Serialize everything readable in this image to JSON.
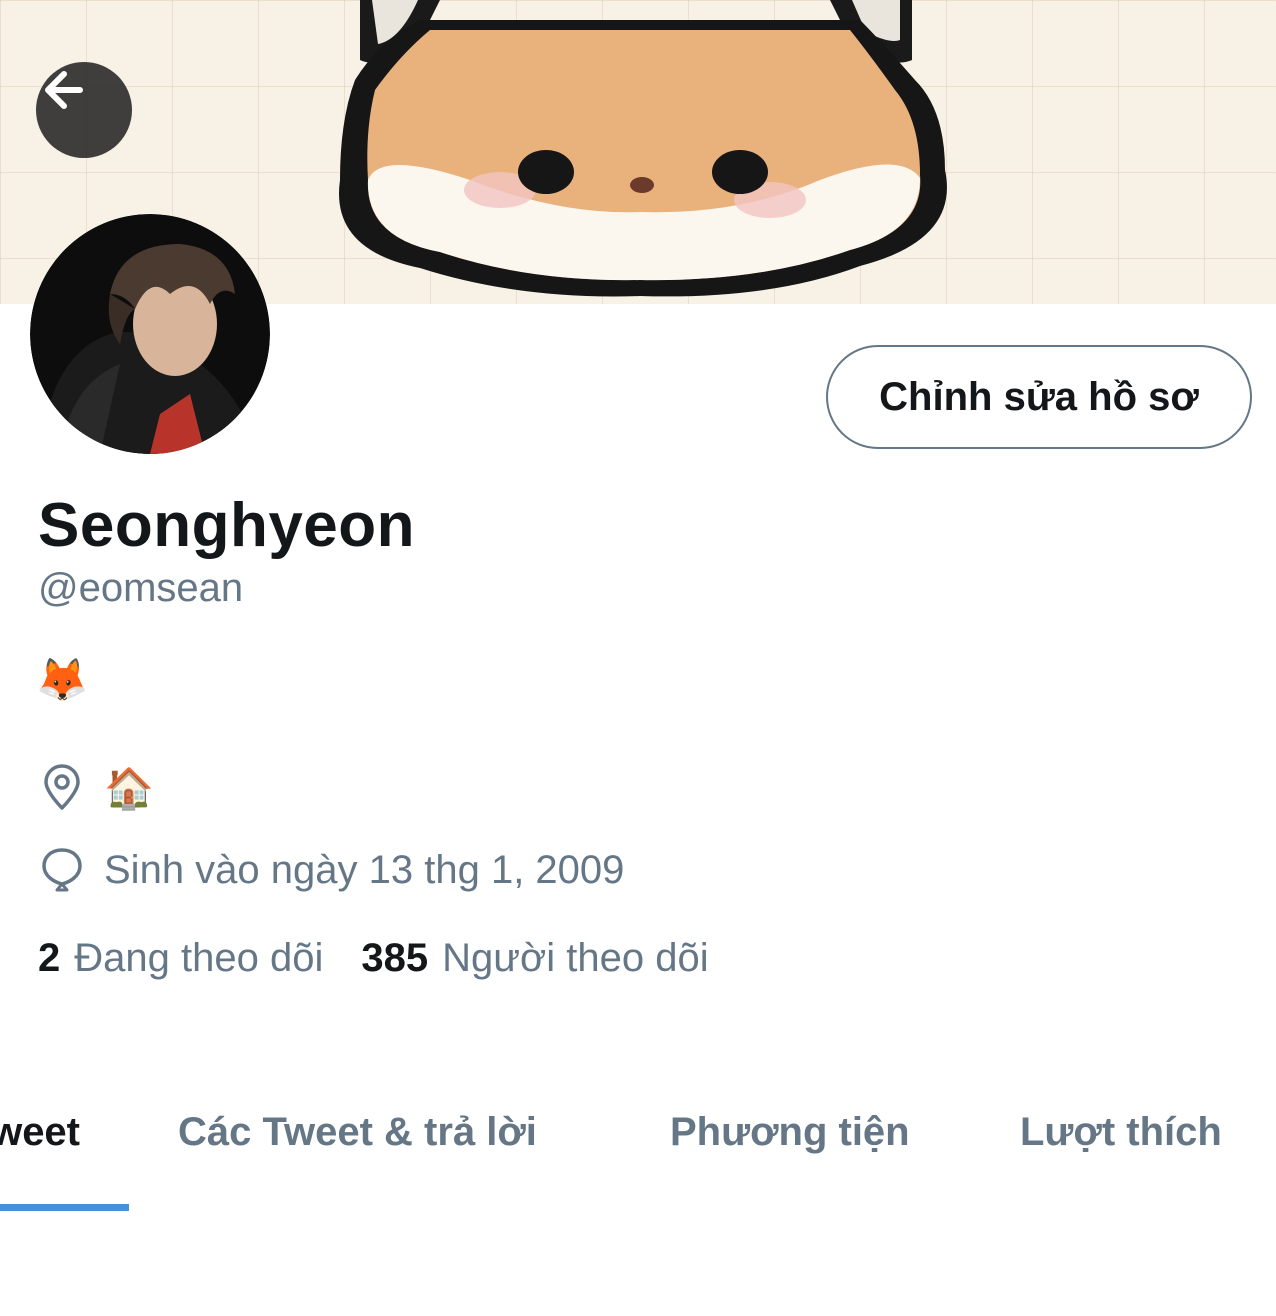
{
  "profile": {
    "edit_button_label": "Chỉnh sửa hồ sơ",
    "display_name": "Seonghyeon",
    "handle": "@eomsean",
    "bio": "🦊",
    "location": "🏠",
    "birthday": "Sinh vào ngày 13 thg 1, 2009",
    "following_count": "2",
    "following_label": "Đang theo dõi",
    "followers_count": "385",
    "followers_label": "Người theo dõi"
  },
  "tabs": [
    {
      "label": "Tweet",
      "active": true
    },
    {
      "label": "Các Tweet & trả lời",
      "active": false
    },
    {
      "label": "Phương tiện",
      "active": false
    },
    {
      "label": "Lượt thích",
      "active": false
    }
  ],
  "colors": {
    "text_primary": "#14171a",
    "text_secondary": "#657786",
    "accent": "#4a90d9",
    "banner_bg": "#f7f1e6"
  },
  "icons": {
    "back": "arrow-left-icon",
    "location": "map-pin-icon",
    "birthday": "balloon-icon"
  }
}
